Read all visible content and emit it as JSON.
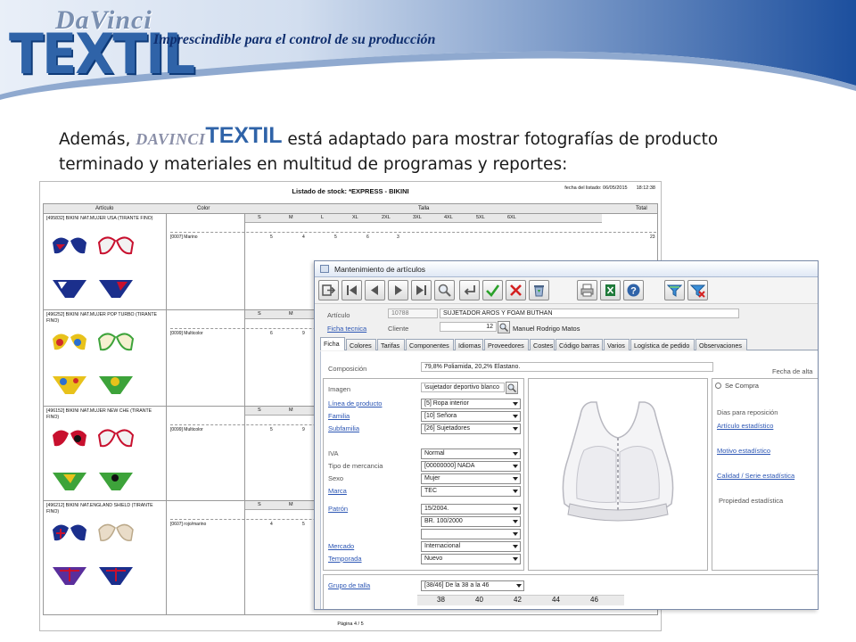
{
  "banner": {
    "logo_top": "DaVinci",
    "logo_main": "TEXTIL",
    "tagline": "Imprescindible para el control de su producción"
  },
  "intro": {
    "prefix": "Además, ",
    "brand_davinci": "DAVINCI",
    "brand_textil": "TEXTIL",
    "line1_rest": " está adaptado para mostrar fotografías de producto",
    "line2": "terminado y materiales en multitud de programas y reportes:"
  },
  "report": {
    "title": "Listado de stock: *EXPRESS - BIKINI",
    "date_label": "fecha del listado: 06/05/2015",
    "time": "18:12:38",
    "headers": {
      "articulo": "Artículo",
      "color": "Color",
      "talla": "Talla",
      "total": "Total"
    },
    "size_labels": [
      "S",
      "M",
      "L",
      "XL",
      "2XL",
      "3XL",
      "4XL",
      "5XL",
      "6XL"
    ],
    "rows": [
      {
        "article": "[495832] BIKINI NAT.MUJER USA (TIRANTE FINO)",
        "color": "[0007] Marino",
        "qty": [
          "5",
          "4",
          "5",
          "6",
          "3"
        ],
        "total": "23"
      },
      {
        "article": "[496252] BIKINI NAT.MUJER POP TURBO (TIRANTE FINO)",
        "color": "[0099] Multicolor",
        "qty": [
          "6",
          "9"
        ],
        "total": ""
      },
      {
        "article": "[496152] BIKINI NAT.MUJER NEW CHE (TIRANTE FINO)",
        "color": "[0099] Multicolor",
        "qty": [
          "5",
          "9"
        ],
        "total": ""
      },
      {
        "article": "[496212] BIKINI NAT.ENGLAND SHIELD (TIRANTE FINO)",
        "color": "[0607] rojo/marino",
        "qty": [
          "4",
          "5"
        ],
        "total": ""
      }
    ],
    "footer": "Página 4 / 5"
  },
  "window": {
    "title": "Mantenimiento de artículos",
    "toolbar": [
      "exit-icon",
      "first-record-icon",
      "previous-record-icon",
      "next-record-icon",
      "last-record-icon",
      "search-icon",
      "return-icon",
      "accept-check-icon",
      "cancel-x-icon",
      "recycle-bin-icon",
      "print-icon",
      "excel-export-icon",
      "help-icon",
      "filter-icon",
      "clear-filter-icon"
    ],
    "articulo_label": "Artículo",
    "articulo_code": "10788",
    "articulo_name": "SUJETADOR AROS Y FOAM BUTHAN",
    "ficha_tecnica_label": "Ficha tecnica",
    "cliente_label": "Cliente",
    "cliente_code": "12",
    "cliente_name": "Manuel Rodrigo Matos",
    "tabs": [
      "Ficha",
      "Colores",
      "Tarifas",
      "Componentes",
      "Idiomas",
      "Proveedores",
      "Costes",
      "Código barras",
      "Varios",
      "Logística de pedido",
      "Observaciones"
    ],
    "composicion_label": "Composición",
    "composicion_value": "79,8% Poliamida, 20,2% Elastano.",
    "fecha_alta_label": "Fecha de alta",
    "imagen_label": "Imagen",
    "imagen_value": "\\sujetador deportivo blanco",
    "linea_label": "Línea de producto",
    "linea_value": "[5] Ropa interior",
    "familia_label": "Familia",
    "familia_value": "[10] Señora",
    "subfamilia_label": "Subfamilia",
    "subfamilia_value": "[26] Sujetadores",
    "iva_label": "IVA",
    "iva_value": "Normal",
    "tipo_label": "Tipo de mercancia",
    "tipo_value": "[00000000] NADA",
    "sexo_label": "Sexo",
    "sexo_value": "Mujer",
    "marca_label": "Marca",
    "marca_value": "TEC",
    "patron_label": "Patrón",
    "patron_value": "15/2004.",
    "patron_value2": "BR. 100/2000",
    "patron_value3": "",
    "mercado_label": "Mercado",
    "mercado_value": "Internacional",
    "temporada_label": "Temporada",
    "temporada_value": "Nuevo",
    "grupo_talla_label": "Grupo de talla",
    "grupo_talla_value": "[38/46] De la 38 a la 46",
    "sizes": [
      "38",
      "40",
      "42",
      "44",
      "46"
    ],
    "se_compra_label": "Se Compra",
    "dias_reposicion_label": "Dias para reposición",
    "articulo_estadistico_label": "Artículo estadístico",
    "motivo_estadistico_label": "Motivo estadístico",
    "calidad_serie_label": "Calidad / Serie estadística",
    "propiedad_label": "Propiedad estadística"
  },
  "colors": {
    "banner_blue": "#1f4f9c",
    "brand_blue": "#2f63a8",
    "link_blue": "#2c56b4",
    "accept_green": "#2aa12a",
    "cancel_red": "#d42020"
  }
}
